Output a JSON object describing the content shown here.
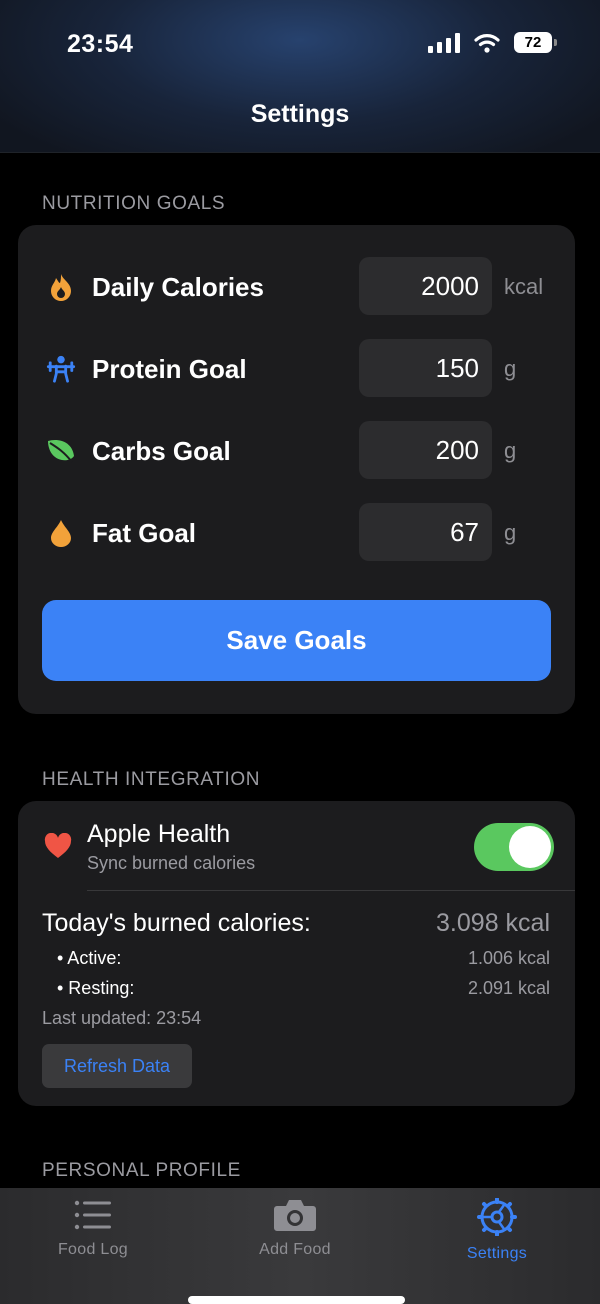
{
  "status_bar": {
    "time": "23:54",
    "battery": "72"
  },
  "nav": {
    "title": "Settings"
  },
  "nutrition": {
    "header": "NUTRITION GOALS",
    "goals": [
      {
        "label": "Daily Calories",
        "value": "2000",
        "unit": "kcal",
        "icon": "flame-icon",
        "color": "#f2a23a"
      },
      {
        "label": "Protein Goal",
        "value": "150",
        "unit": "g",
        "icon": "weightlifter-icon",
        "color": "#3b82f6"
      },
      {
        "label": "Carbs Goal",
        "value": "200",
        "unit": "g",
        "icon": "leaf-icon",
        "color": "#5ac85f"
      },
      {
        "label": "Fat Goal",
        "value": "67",
        "unit": "g",
        "icon": "drop-icon",
        "color": "#f2a23a"
      }
    ],
    "save_label": "Save Goals"
  },
  "health": {
    "header": "HEALTH INTEGRATION",
    "app_name": "Apple Health",
    "subtitle": "Sync burned calories",
    "toggle_on": true,
    "burned_label": "Today's burned calories:",
    "burned_total": "3.098 kcal",
    "active_label": "• Active:",
    "active_value": "1.006 kcal",
    "resting_label": "• Resting:",
    "resting_value": "2.091 kcal",
    "last_updated": "Last updated: 23:54",
    "refresh_label": "Refresh Data"
  },
  "profile": {
    "header": "PERSONAL PROFILE"
  },
  "tabbar": {
    "tabs": [
      {
        "label": "Food Log",
        "icon": "list-icon",
        "active": false
      },
      {
        "label": "Add Food",
        "icon": "camera-icon",
        "active": false
      },
      {
        "label": "Settings",
        "icon": "gear-icon",
        "active": true
      }
    ]
  },
  "colors": {
    "accent": "#3b82f6",
    "toggle": "#5ac85f",
    "heart": "#f05545"
  }
}
